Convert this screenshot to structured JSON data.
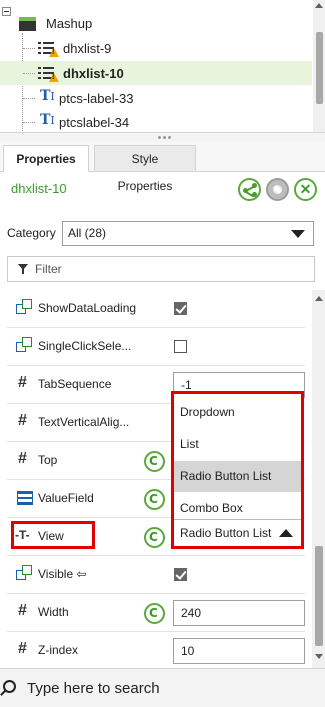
{
  "tree": {
    "items": [
      {
        "label": "Mashup"
      },
      {
        "label": "dhxlist-9"
      },
      {
        "label": "dhxlist-10"
      },
      {
        "label": "ptcs-label-33"
      },
      {
        "label": "ptcslabel-34"
      }
    ]
  },
  "tabs": {
    "properties": "Properties",
    "style": "Style Properties"
  },
  "header": {
    "name": "dhxlist-10"
  },
  "category": {
    "label": "Category",
    "value": "All (28)"
  },
  "filter": {
    "placeholder": "Filter"
  },
  "props": [
    {
      "name": "ShowDataLoading",
      "checked": true
    },
    {
      "name": "SingleClickSele...",
      "checked": false
    },
    {
      "name": "TabSequence",
      "value": "-1"
    },
    {
      "name": "TextVerticalAlig..."
    },
    {
      "name": "Top"
    },
    {
      "name": "ValueField"
    },
    {
      "name": "View",
      "value": "Radio Button List"
    },
    {
      "name": "Visible ⇦",
      "checked": true
    },
    {
      "name": "Width",
      "value": "240"
    },
    {
      "name": "Z-index",
      "value": "10"
    }
  ],
  "dropdown": {
    "options": [
      "Dropdown",
      "List",
      "Radio Button List",
      "Combo Box"
    ],
    "selected": "Radio Button List",
    "current": "Radio Button List"
  },
  "taskbar": {
    "search_placeholder": "Type here to search"
  },
  "colors": {
    "accent_green": "#3a9b2a",
    "highlight_red": "#e10000",
    "selected_row": "#e8f5dc"
  }
}
